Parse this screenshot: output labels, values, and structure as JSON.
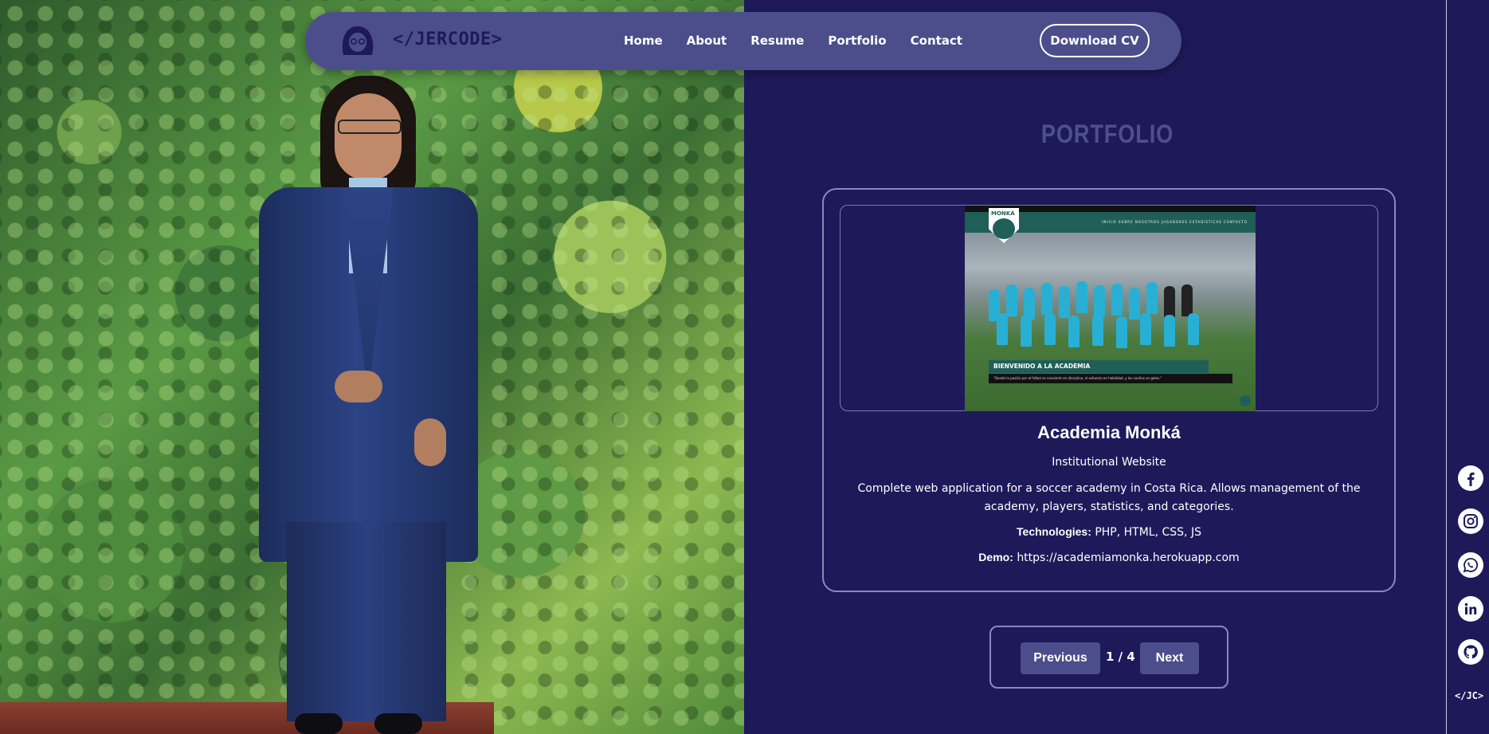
{
  "nav": {
    "logo_text": "</JERCODE>",
    "links": [
      "Home",
      "About",
      "Resume",
      "Portfolio",
      "Contact"
    ],
    "cta": "Download CV"
  },
  "section": {
    "title": "PORTFOLIO"
  },
  "project": {
    "name": "Academia Monká",
    "type": "Institutional Website",
    "description": "Complete web application for a soccer academy in Costa Rica. Allows management of the academy, players, statistics, and categories.",
    "technologies_label": "Technologies:",
    "technologies": "PHP, HTML, CSS, JS",
    "demo_label": "Demo:",
    "demo_url": "https://academiamonka.herokuapp.com",
    "screenshot": {
      "badge": "MONKÁ",
      "nav_items": "INICIO   SOBRE NOSOTROS   JUGADORES   ESTADISTICAS   CONTACTO",
      "banner": "BIENVENIDO A LA ACADEMIA",
      "quote": "“Donde la pasión por el fútbol se convierte en disciplina, el esfuerzo en habilidad, y los sueños en goles.”"
    }
  },
  "pagination": {
    "prev": "Previous",
    "next": "Next",
    "current": "1 / 4"
  },
  "social": {
    "icons": [
      "facebook-icon",
      "instagram-icon",
      "whatsapp-icon",
      "linkedin-icon",
      "github-icon"
    ],
    "footer_mark": "</JC>"
  },
  "colors": {
    "background": "#1e1a5a",
    "nav": "#4b4e8b",
    "title": "#4d4f8e",
    "accent_green": "#1f5f57"
  }
}
